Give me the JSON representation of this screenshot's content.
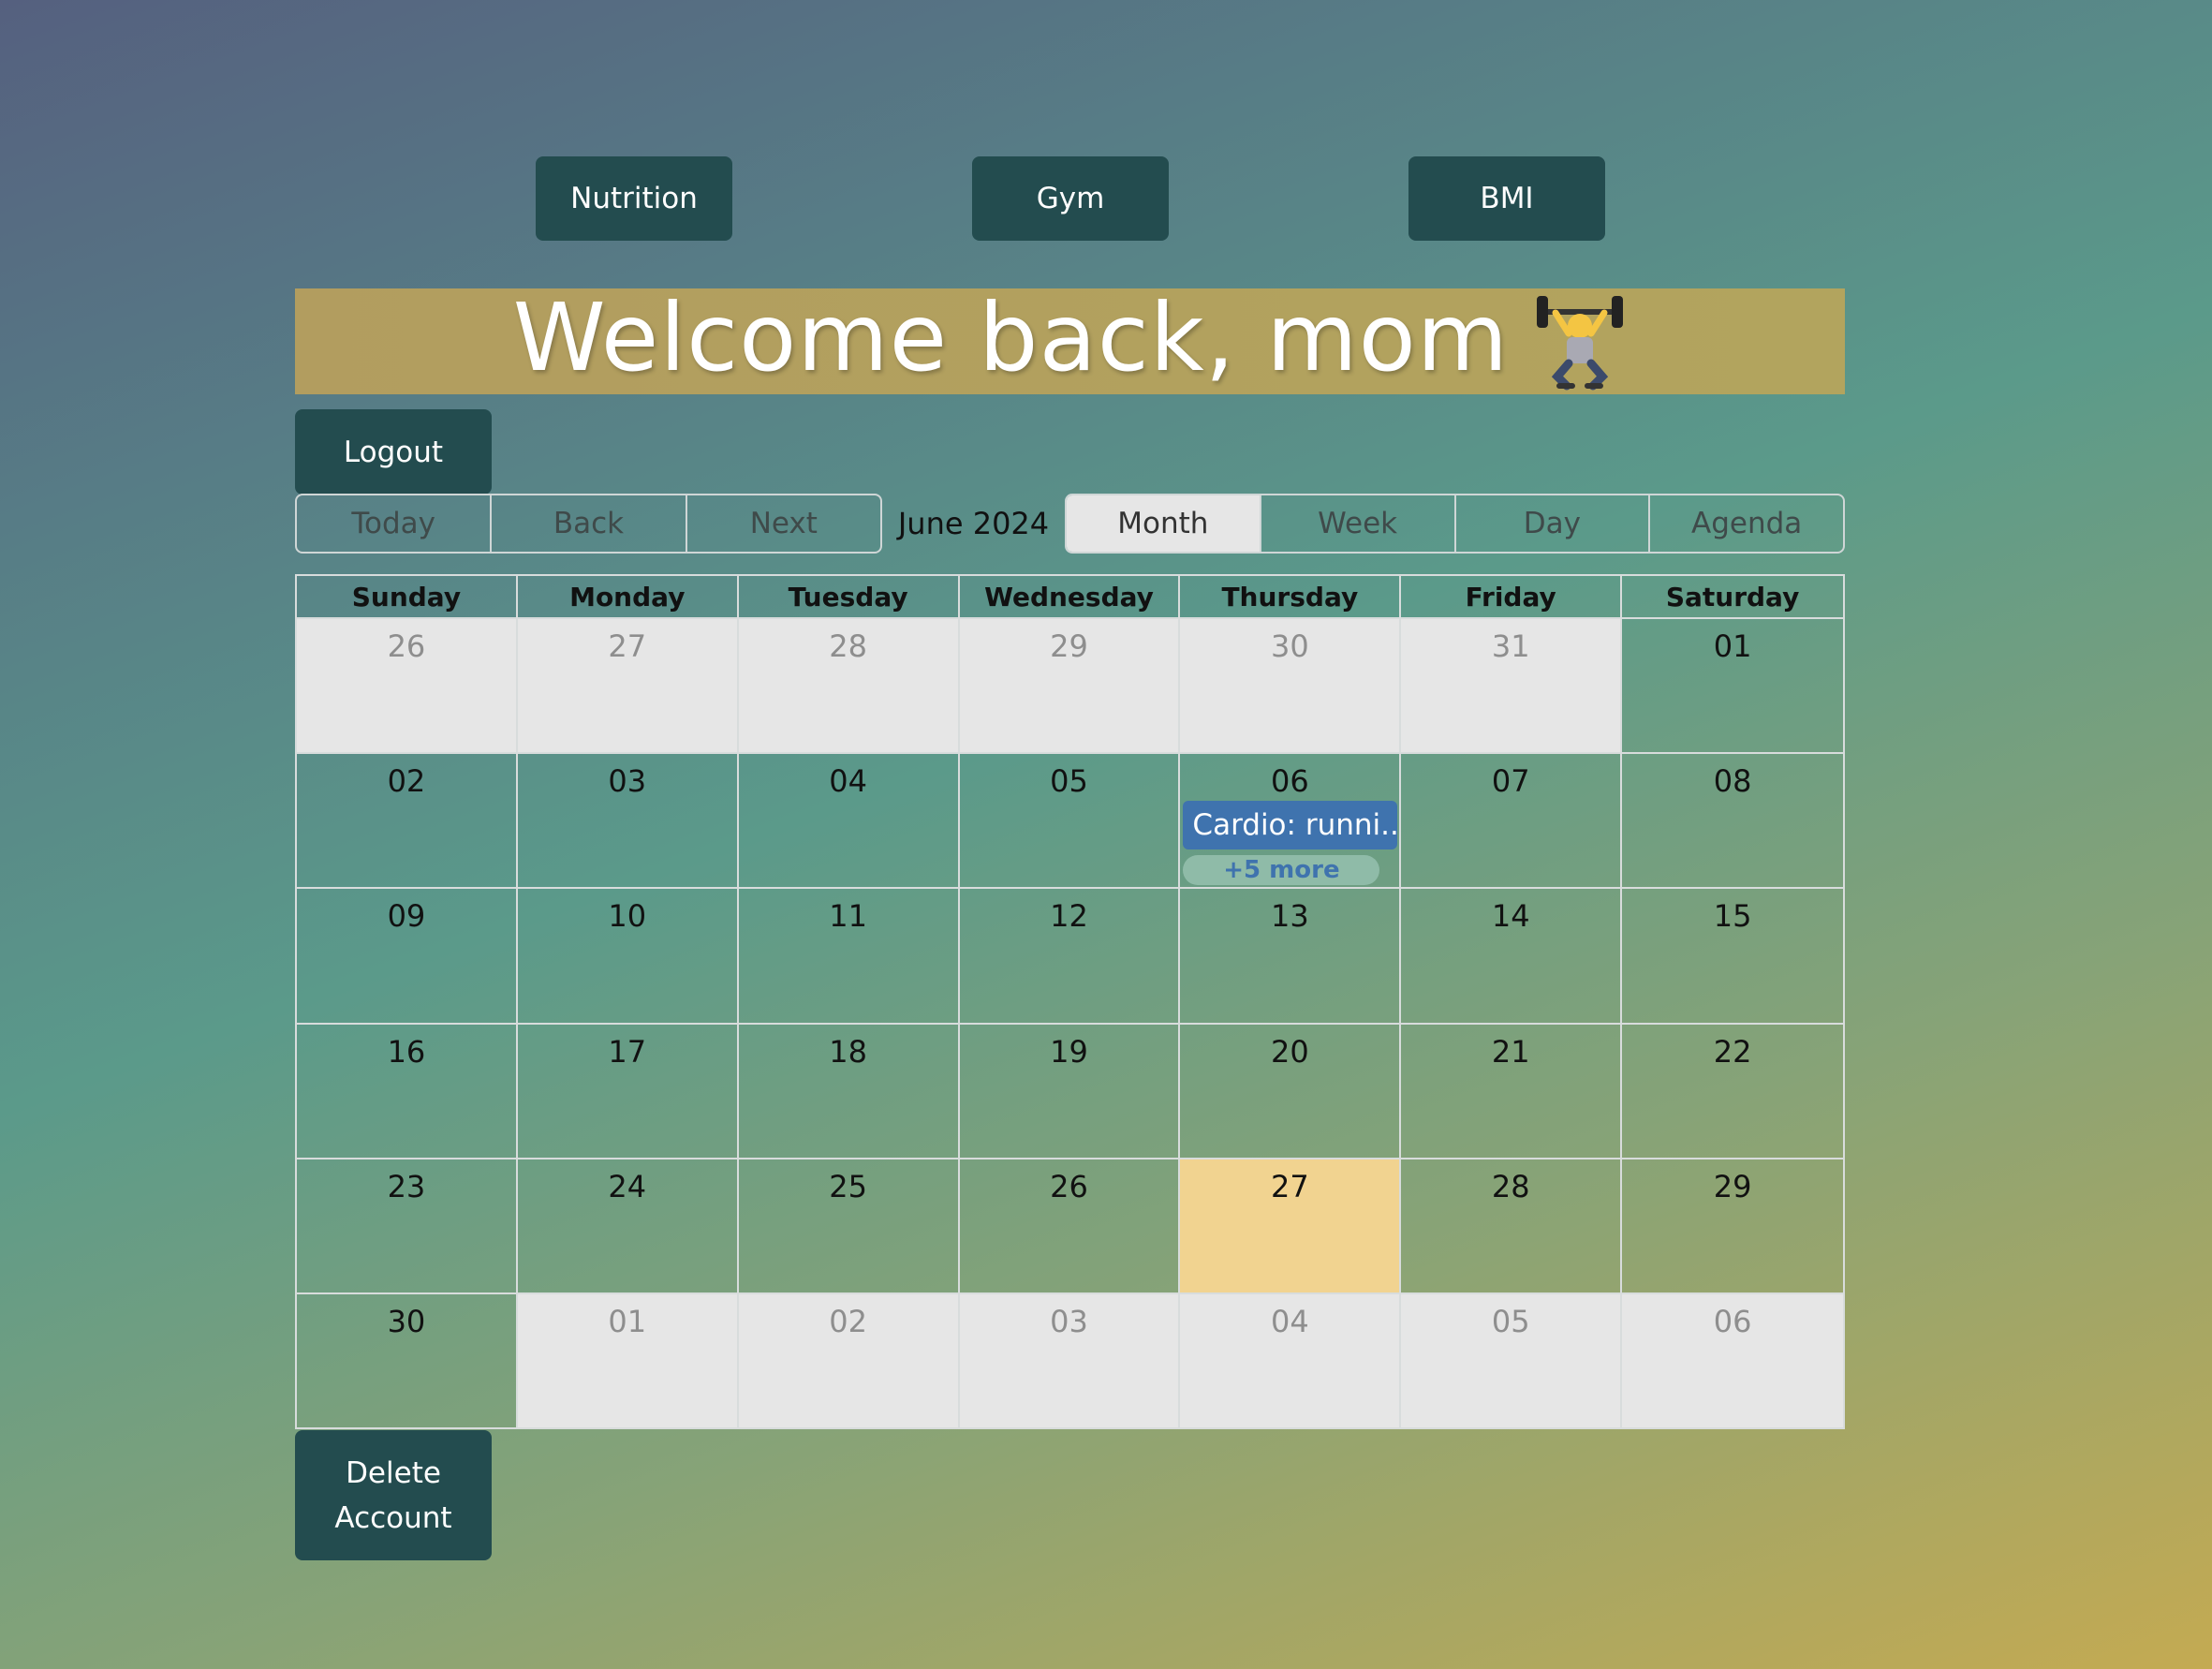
{
  "nav": {
    "nutrition_label": "Nutrition",
    "gym_label": "Gym",
    "bmi_label": "BMI"
  },
  "banner": {
    "title": "Welcome back, mom",
    "emoji_icon": "weightlifter-icon"
  },
  "account": {
    "logout_label": "Logout",
    "delete_label": "Delete Account"
  },
  "toolbar": {
    "today_label": "Today",
    "back_label": "Back",
    "next_label": "Next",
    "month_label": "June 2024",
    "views": [
      "Month",
      "Week",
      "Day",
      "Agenda"
    ],
    "active_view": "Month"
  },
  "calendar": {
    "weekdays": [
      "Sunday",
      "Monday",
      "Tuesday",
      "Wednesday",
      "Thursday",
      "Friday",
      "Saturday"
    ],
    "weeks": [
      [
        "26",
        "27",
        "28",
        "29",
        "30",
        "31",
        "01"
      ],
      [
        "02",
        "03",
        "04",
        "05",
        "06",
        "07",
        "08"
      ],
      [
        "09",
        "10",
        "11",
        "12",
        "13",
        "14",
        "15"
      ],
      [
        "16",
        "17",
        "18",
        "19",
        "20",
        "21",
        "22"
      ],
      [
        "23",
        "24",
        "25",
        "26",
        "27",
        "28",
        "29"
      ],
      [
        "30",
        "01",
        "02",
        "03",
        "04",
        "05",
        "06"
      ]
    ],
    "event": {
      "label": "Cardio: runni...",
      "more_label": "+5 more"
    }
  },
  "colors": {
    "button_bg": "#234c4f",
    "banner_bg": "#b2a05e",
    "event_bg": "#3f73ae",
    "today_bg": "#f1d390",
    "off_range_bg": "#e6e6e6"
  }
}
